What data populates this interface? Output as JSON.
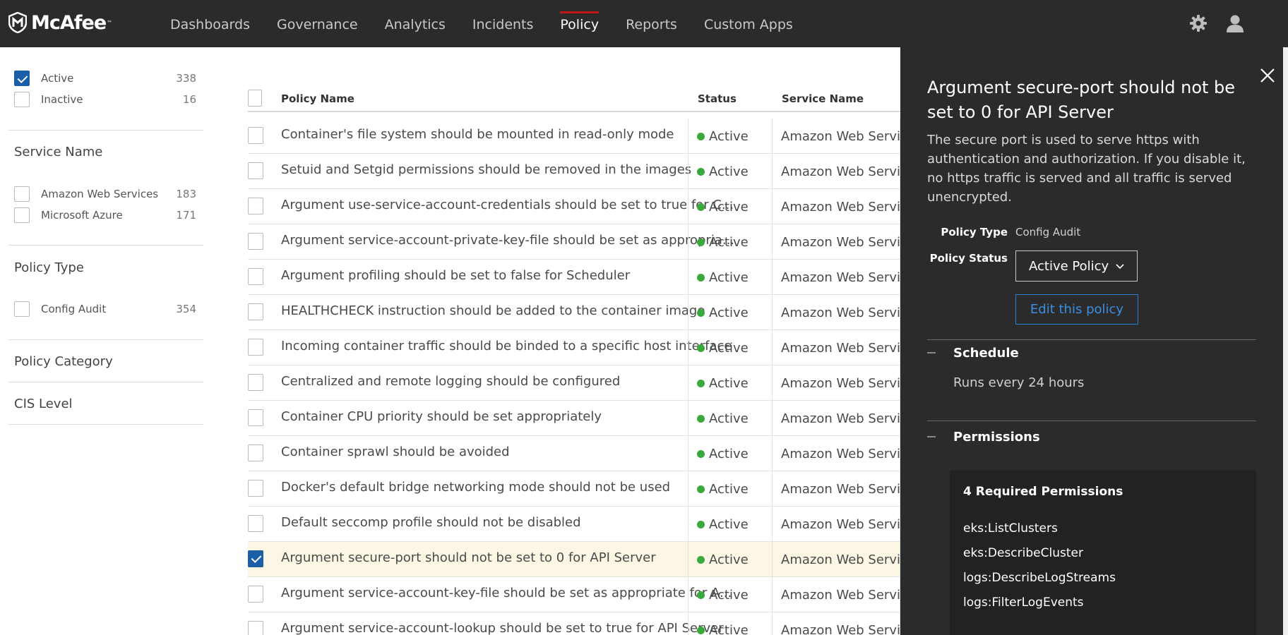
{
  "brand": {
    "name": "McAfee",
    "trademark": "™"
  },
  "nav": {
    "items": [
      {
        "label": "Dashboards",
        "active": false
      },
      {
        "label": "Governance",
        "active": false
      },
      {
        "label": "Analytics",
        "active": false
      },
      {
        "label": "Incidents",
        "active": false
      },
      {
        "label": "Policy",
        "active": true
      },
      {
        "label": "Reports",
        "active": false
      },
      {
        "label": "Custom Apps",
        "active": false
      }
    ],
    "accent_color": "#c01818",
    "icons": [
      "gear-icon",
      "user-icon"
    ]
  },
  "filters": {
    "status": [
      {
        "label": "Active",
        "count": "338",
        "checked": true
      },
      {
        "label": "Inactive",
        "count": "16",
        "checked": false
      }
    ],
    "service_name": {
      "heading": "Service Name",
      "options": [
        {
          "label": "Amazon Web Services",
          "count": "183",
          "checked": false
        },
        {
          "label": "Microsoft Azure",
          "count": "171",
          "checked": false
        }
      ]
    },
    "policy_type": {
      "heading": "Policy Type",
      "options": [
        {
          "label": "Config Audit",
          "count": "354",
          "checked": false
        }
      ]
    },
    "policy_category": {
      "heading": "Policy Category"
    },
    "cis_level": {
      "heading": "CIS Level"
    }
  },
  "table": {
    "columns": {
      "name": "Policy Name",
      "status": "Status",
      "service": "Service Name"
    },
    "rows": [
      {
        "name": "Container's file system should be mounted in read-only mode",
        "status": "Active",
        "service": "Amazon Web Services",
        "checked": false
      },
      {
        "name": "Setuid and Setgid permissions should be removed in the images",
        "status": "Active",
        "service": "Amazon Web Services",
        "checked": false
      },
      {
        "name": "Argument use-service-account-credentials should be set to true for C...",
        "status": "Active",
        "service": "Amazon Web Services",
        "checked": false
      },
      {
        "name": "Argument service-account-private-key-file should be set as appropria...",
        "status": "Active",
        "service": "Amazon Web Services",
        "checked": false
      },
      {
        "name": "Argument profiling should be set to false for Scheduler",
        "status": "Active",
        "service": "Amazon Web Services",
        "checked": false
      },
      {
        "name": "HEALTHCHECK instruction should be added to the container image",
        "status": "Active",
        "service": "Amazon Web Services",
        "checked": false
      },
      {
        "name": "Incoming container traffic should be binded to a specific host interface",
        "status": "Active",
        "service": "Amazon Web Services",
        "checked": false
      },
      {
        "name": "Centralized and remote logging should be configured",
        "status": "Active",
        "service": "Amazon Web Services",
        "checked": false
      },
      {
        "name": "Container CPU priority should be set appropriately",
        "status": "Active",
        "service": "Amazon Web Services",
        "checked": false
      },
      {
        "name": "Container sprawl should be avoided",
        "status": "Active",
        "service": "Amazon Web Services",
        "checked": false
      },
      {
        "name": "Docker's default bridge networking mode should not be used",
        "status": "Active",
        "service": "Amazon Web Services",
        "checked": false
      },
      {
        "name": "Default seccomp profile should not be disabled",
        "status": "Active",
        "service": "Amazon Web Services",
        "checked": false
      },
      {
        "name": "Argument secure-port should not be set to 0 for API Server",
        "status": "Active",
        "service": "Amazon Web Services",
        "checked": true
      },
      {
        "name": "Argument service-account-key-file should be set as appropriate for A...",
        "status": "Active",
        "service": "Amazon Web Services",
        "checked": false
      },
      {
        "name": "Argument service-account-lookup should be set to true for API Server",
        "status": "Active",
        "service": "Amazon Web Services",
        "checked": false
      }
    ]
  },
  "detail": {
    "title": "Argument secure-port should not be set to 0 for API Server",
    "description": "The secure port is used to serve https with authentication and authorization. If you disable it, no https traffic is served and all traffic is served unencrypted.",
    "policy_type_label": "Policy Type",
    "policy_type_value": "Config Audit",
    "policy_status_label": "Policy Status",
    "policy_status_value": "Active Policy",
    "edit_button": "Edit this policy",
    "schedule": {
      "heading": "Schedule",
      "text": "Runs every 24 hours"
    },
    "permissions": {
      "heading": "Permissions",
      "count_title": "4 Required Permissions",
      "items": [
        "eks:ListClusters",
        "eks:DescribeCluster",
        "logs:DescribeLogStreams",
        "logs:FilterLogEvents"
      ]
    },
    "link_color": "#2a7fd2"
  }
}
